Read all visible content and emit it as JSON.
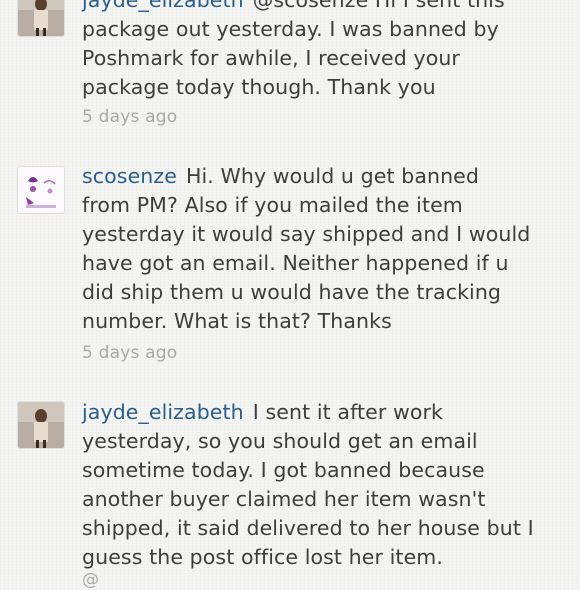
{
  "comments": [
    {
      "username": "jayde_elizabeth",
      "lines": [
        "@scosenze Hi I sent this",
        "package out yesterday. I was banned by",
        "Poshmark for awhile, I received your",
        "package today though. Thank you"
      ],
      "time": "5 days ago"
    },
    {
      "username": "scosenze",
      "lines": [
        "Hi. Why would u get banned",
        "from PM? Also if you mailed the item",
        "yesterday it would say shipped and I would",
        "have got an email. Neither happened  if u",
        "did ship them u would have the tracking",
        "number. What is that? Thanks"
      ],
      "time": "5 days ago"
    },
    {
      "username": "jayde_elizabeth",
      "lines": [
        "I sent it after work",
        "yesterday, so you should get an email",
        "sometime today. I got banned because",
        "another buyer claimed her item wasn't",
        "shipped, it said delivered to her house but I",
        "guess the post office lost her item."
      ],
      "time": "@"
    }
  ]
}
